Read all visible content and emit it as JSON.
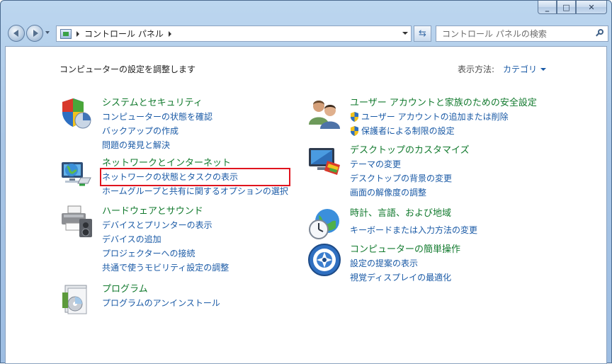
{
  "window": {
    "caption": {
      "minimize_glyph": "_",
      "maximize_glyph": "□",
      "close_glyph": "✕"
    }
  },
  "address": {
    "crumbs": [
      "コントロール パネル"
    ],
    "search_placeholder": "コントロール パネルの検索"
  },
  "content": {
    "heading": "コンピューターの設定を調整します",
    "view_by_label": "表示方法:",
    "view_by_value": "カテゴリ"
  },
  "categories": {
    "system": {
      "title": "システムとセキュリティ",
      "links": [
        "コンピューターの状態を確認",
        "バックアップの作成",
        "問題の発見と解決"
      ]
    },
    "network": {
      "title": "ネットワークとインターネット",
      "links": [
        "ネットワークの状態とタスクの表示",
        "ホームグループと共有に関するオプションの選択"
      ]
    },
    "hardware": {
      "title": "ハードウェアとサウンド",
      "links": [
        "デバイスとプリンターの表示",
        "デバイスの追加",
        "プロジェクターへの接続",
        "共通で使うモビリティ設定の調整"
      ]
    },
    "programs": {
      "title": "プログラム",
      "links": [
        "プログラムのアンインストール"
      ]
    },
    "users": {
      "title": "ユーザー アカウントと家族のための安全設定",
      "links": [
        "ユーザー アカウントの追加または削除",
        "保護者による制限の設定"
      ]
    },
    "appearance": {
      "title": "デスクトップのカスタマイズ",
      "links": [
        "テーマの変更",
        "デスクトップの背景の変更",
        "画面の解像度の調整"
      ]
    },
    "clock": {
      "title": "時計、言語、および地域",
      "links": [
        "キーボードまたは入力方法の変更"
      ]
    },
    "ease": {
      "title": "コンピューターの簡単操作",
      "links": [
        "設定の提案の表示",
        "視覚ディスプレイの最適化"
      ]
    }
  },
  "colors": {
    "category_title": "#127a2e",
    "link": "#1a5aa6",
    "highlight": "#e0141e"
  }
}
